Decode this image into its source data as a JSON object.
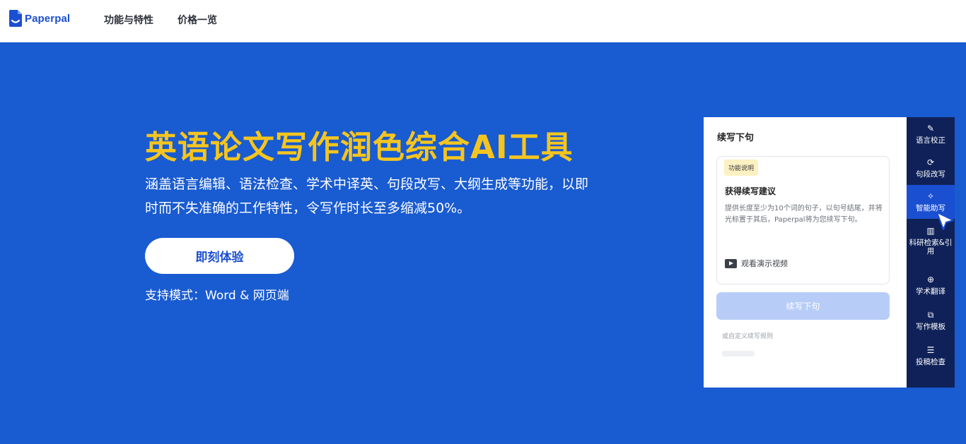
{
  "brand": {
    "name": "Paperpal",
    "color": "#1b4fd1"
  },
  "nav": [
    {
      "label": "功能与特性"
    },
    {
      "label": "价格一览"
    }
  ],
  "hero": {
    "title": "英语论文写作润色综合AI工具",
    "description": "涵盖语言编辑、语法检查、学术中译英、句段改写、大纲生成等功能，以即时而不失准确的工作特性，令写作时长至多缩减50%。",
    "cta_label": "即刻体验",
    "support_text": "支持模式：Word & 网页端",
    "bg_color": "#195bd0",
    "title_color": "#f5c51f"
  },
  "demo": {
    "panel_title": "续写下句",
    "card": {
      "badge": "功能说明",
      "title": "获得续写建议",
      "text": "提供长度至少为10个词的句子，以句号结尾，并将光标置于其后，Paperpal将为您续写下句。",
      "video_label": "观看演示视频",
      "video_icon": "play-icon"
    },
    "generate_button": "续写下句",
    "custom_rule": "或自定义续写规则",
    "sidebar": [
      {
        "label": "语言校正",
        "icon": "pen-icon",
        "glyph": "✎",
        "active": false
      },
      {
        "label": "句段改写",
        "icon": "refresh-icon",
        "glyph": "⟳",
        "active": false
      },
      {
        "label": "智能助写",
        "icon": "sparkle-icon",
        "glyph": "✧",
        "active": true
      },
      {
        "label": "科研检索&引用",
        "icon": "library-icon",
        "glyph": "▥",
        "active": false
      },
      {
        "label": "学术翻译",
        "icon": "globe-icon",
        "glyph": "⊕",
        "active": false
      },
      {
        "label": "写作模板",
        "icon": "template-icon",
        "glyph": "⧉",
        "active": false
      },
      {
        "label": "投稿检查",
        "icon": "checklist-icon",
        "glyph": "☰",
        "active": false
      }
    ]
  }
}
